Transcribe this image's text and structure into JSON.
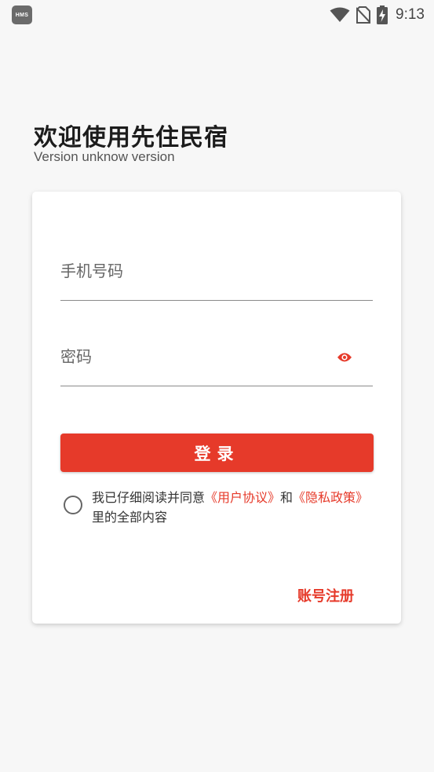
{
  "status_bar": {
    "badge": "HMS",
    "time": "9:13",
    "icons": [
      "hms-icon",
      "wifi-icon",
      "no-sim-icon",
      "battery-charging-icon"
    ]
  },
  "header": {
    "title": "欢迎使用先住民宿",
    "version": "Version unknow version"
  },
  "form": {
    "phone_placeholder": "手机号码",
    "password_placeholder": "密码",
    "password_toggle_icon": "eye-icon",
    "login_label": "登录",
    "agreement": {
      "prefix": "我已仔细阅读并同意",
      "user_agreement": "《用户协议》",
      "conjunction": "和",
      "privacy_policy": "《隐私政策》",
      "suffix": "里的全部内容"
    },
    "register_label": "账号注册"
  },
  "colors": {
    "accent": "#e63a2a",
    "background": "#f7f7f7",
    "card": "#ffffff"
  }
}
